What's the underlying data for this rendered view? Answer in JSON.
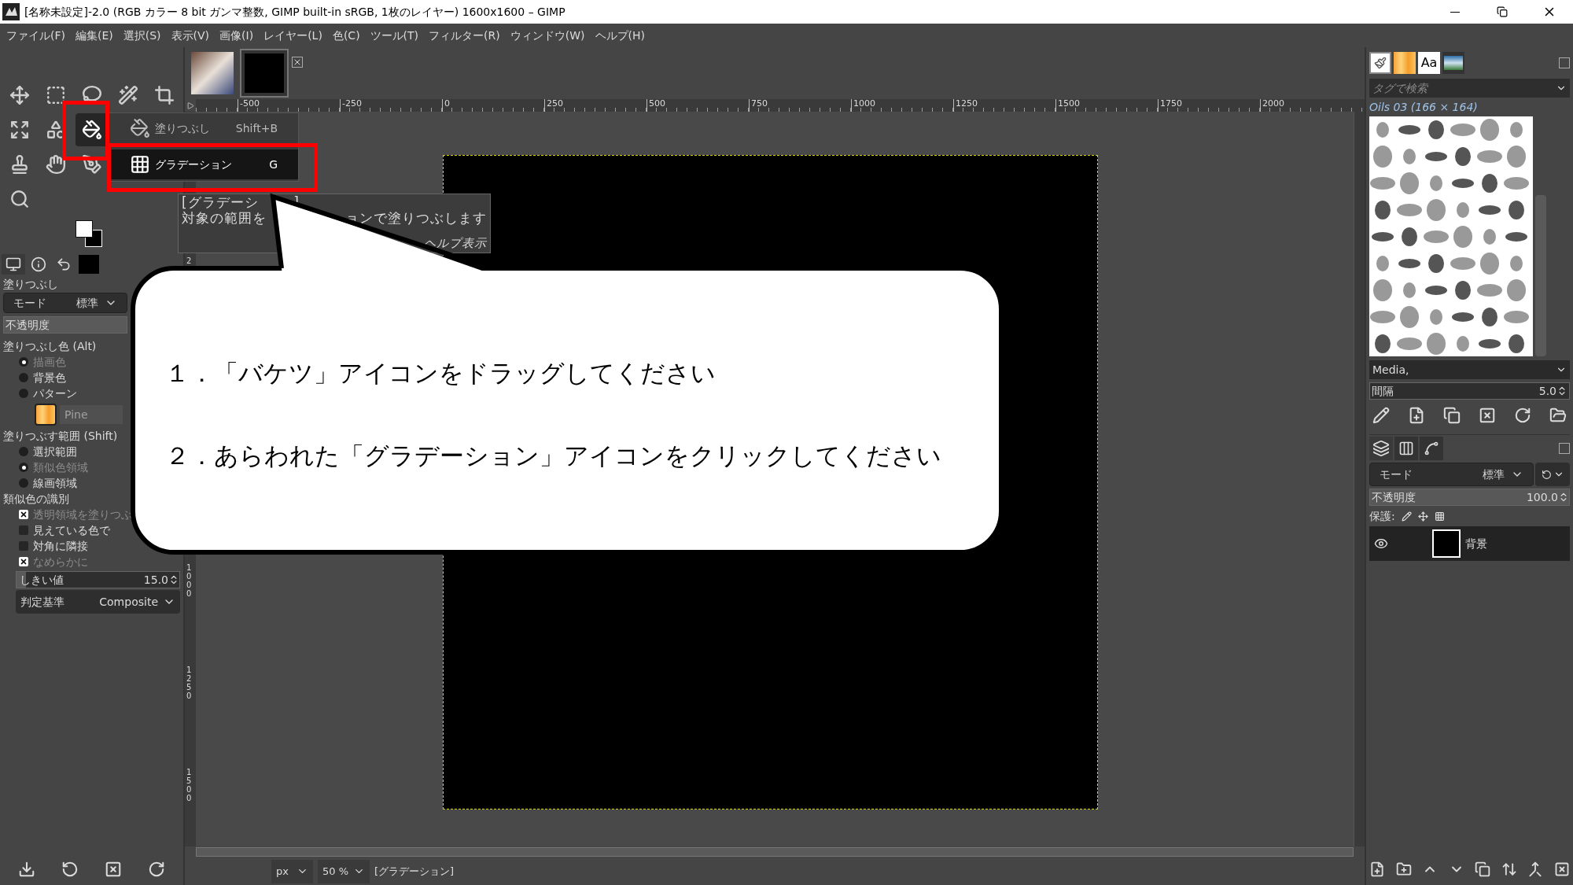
{
  "window": {
    "title": "[名称未設定]-2.0 (RGB カラー 8 bit ガンマ整数, GIMP built-in sRGB, 1枚のレイヤー) 1600x1600 – GIMP"
  },
  "menu": [
    "ファイル(F)",
    "編集(E)",
    "選択(S)",
    "表示(V)",
    "画像(I)",
    "レイヤー(L)",
    "色(C)",
    "ツール(T)",
    "フィルター(R)",
    "ウィンドウ(W)",
    "ヘルプ(H)"
  ],
  "toolbox": {
    "rows": [
      [
        {
          "kind": "move",
          "selected": false
        },
        {
          "kind": "rect_select",
          "selected": false
        },
        {
          "kind": "lasso",
          "selected": false
        },
        {
          "kind": "wand",
          "selected": false
        },
        {
          "kind": "crop",
          "selected": false
        }
      ],
      [
        {
          "kind": "transform",
          "selected": false
        },
        {
          "kind": "warp",
          "selected": false
        },
        {
          "kind": "bucket",
          "selected": true
        }
      ],
      [
        {
          "kind": "clone",
          "selected": false
        },
        {
          "kind": "smudge",
          "selected": false
        },
        {
          "kind": "path",
          "selected": false
        }
      ],
      [
        {
          "kind": "zoom",
          "selected": false
        }
      ]
    ]
  },
  "tool_group_menu": [
    {
      "label": "塗りつぶし",
      "shortcut": "Shift+B",
      "selected": false
    },
    {
      "label": "グラデーション",
      "shortcut": "G",
      "selected": true
    }
  ],
  "tooltip": [
    [
      "[グラデーシ",
      "]"
    ],
    [
      "対象の範囲を",
      "ョンで塗りつぶします"
    ],
    [
      "ヘルプ表示"
    ]
  ],
  "tool_options": {
    "title": "塗りつぶし",
    "mode": {
      "label": "モード",
      "value": "標準"
    },
    "opacity": {
      "label": "不透明度",
      "level": 1
    },
    "fill_type": {
      "label": "塗りつぶし色 (Alt)",
      "options": [
        {
          "label": "描画色",
          "selected": true
        },
        {
          "label": "背景色",
          "selected": false
        },
        {
          "label": "パターン",
          "selected": false
        }
      ],
      "pattern": "Pine"
    },
    "fill_area": {
      "label": "塗りつぶす範囲 (Shift)",
      "options": [
        {
          "label": "選択範囲",
          "selected": false
        },
        {
          "label": "類似色領域",
          "selected": true
        },
        {
          "label": "線画領域",
          "selected": false
        }
      ]
    },
    "similar": {
      "label": "類似色の識別",
      "checks": [
        {
          "label": "透明領域を塗りつぶ",
          "checked": true
        },
        {
          "label": "見えている色で",
          "checked": false
        },
        {
          "label": "対角に隣接",
          "checked": false
        },
        {
          "label": "なめらかに",
          "checked": true
        }
      ]
    },
    "threshold": {
      "label": "しきい値",
      "value": "15.0",
      "level": 0.06
    },
    "criterion": {
      "label": "判定基準",
      "value": "Composite"
    }
  },
  "image_tabs": [
    {
      "kind": "photo",
      "selected": false
    },
    {
      "kind": "blank",
      "selected": true
    }
  ],
  "rulers": {
    "horizontal": [
      "-500",
      "-250",
      "0",
      "250",
      "500",
      "750",
      "1000",
      "1250",
      "1500",
      "1750",
      "2000"
    ],
    "vertical": [
      "2",
      "1000",
      "1250",
      "1500"
    ]
  },
  "status_bar": {
    "unit": "px",
    "zoom": "50 %",
    "message": "[グラデーション]"
  },
  "dock": {
    "font_tab": "Aa",
    "tag_search": {
      "placeholder": "タグで検索"
    },
    "brush_name": "Oils 03 (166 × 164)",
    "brush_tags": "Media,",
    "spacing": {
      "label": "間隔",
      "value": "5.0"
    },
    "layers": {
      "mode": {
        "label": "モード",
        "value": "標準"
      },
      "opacity": {
        "label": "不透明度",
        "value": "100.0",
        "level": 1
      },
      "lock_label": "保護:",
      "items": [
        {
          "name": "背景",
          "visible": true
        }
      ]
    }
  },
  "callout": {
    "steps": [
      "１．「バケツ」アイコンをドラッグしてください",
      "２．あらわれた「グラデーション」アイコンをクリックしてください"
    ]
  }
}
